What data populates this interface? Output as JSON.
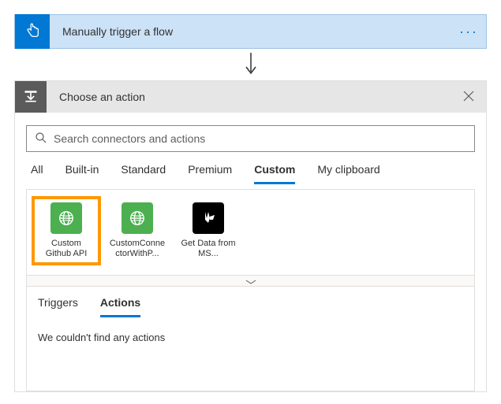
{
  "trigger": {
    "title": "Manually trigger a flow"
  },
  "action": {
    "headerTitle": "Choose an action",
    "search": {
      "placeholder": "Search connectors and actions"
    },
    "categoryTabs": {
      "all": "All",
      "builtin": "Built-in",
      "standard": "Standard",
      "premium": "Premium",
      "custom": "Custom",
      "clipboard": "My clipboard"
    },
    "connectors": [
      {
        "label": "Custom Github API"
      },
      {
        "label": "CustomConnectorWithP..."
      },
      {
        "label": "Get Data from MS..."
      }
    ],
    "subTabs": {
      "triggers": "Triggers",
      "actions": "Actions"
    },
    "emptyMessage": "We couldn't find any actions"
  }
}
